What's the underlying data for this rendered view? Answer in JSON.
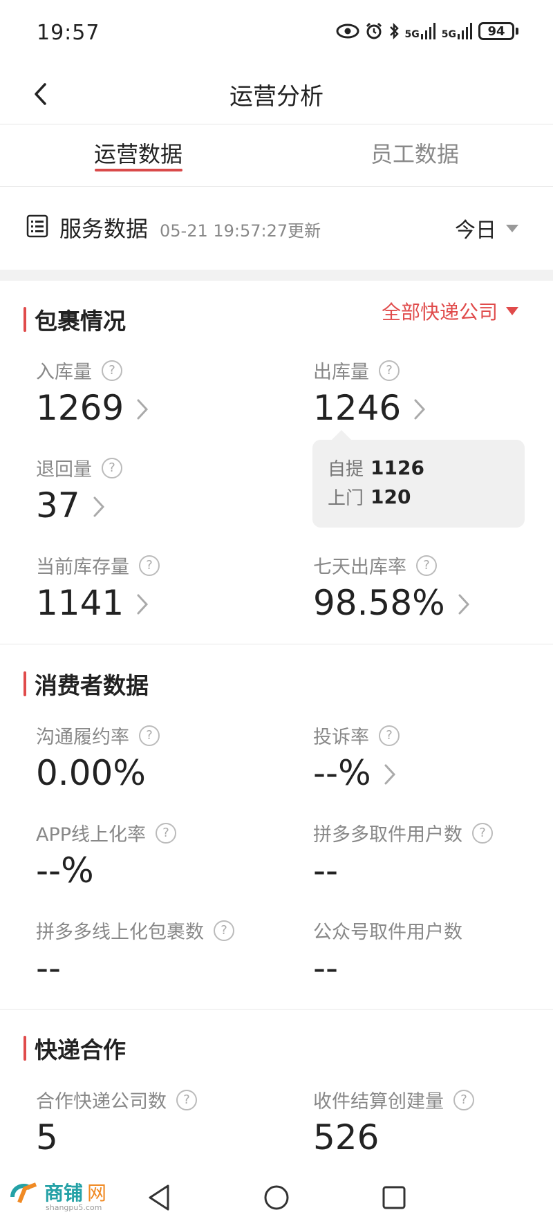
{
  "status_bar": {
    "time": "19:57",
    "battery": "94",
    "net1": "5G",
    "net2": "5G"
  },
  "nav": {
    "title": "运营分析"
  },
  "tabs": [
    {
      "label": "运营数据",
      "active": true
    },
    {
      "label": "员工数据",
      "active": false
    }
  ],
  "service": {
    "title": "服务数据",
    "update_time": "05-21 19:57:27更新",
    "period": "今日"
  },
  "packages": {
    "title": "包裹情况",
    "filter": "全部快递公司",
    "metrics": [
      {
        "label": "入库量",
        "value": "1269"
      },
      {
        "label": "出库量",
        "value": "1246"
      },
      {
        "label": "退回量",
        "value": "37"
      },
      {
        "label": "当前库存量",
        "value": "1141"
      },
      {
        "label": "七天出库率",
        "value": "98.58%"
      }
    ],
    "tooltip": [
      {
        "label": "自提",
        "value": "1126"
      },
      {
        "label": "上门",
        "value": "120"
      }
    ]
  },
  "consumer": {
    "title": "消费者数据",
    "metrics": [
      {
        "label": "沟通履约率",
        "value": "0.00%"
      },
      {
        "label": "投诉率",
        "value": "--%"
      },
      {
        "label": "APP线上化率",
        "value": "--%"
      },
      {
        "label": "拼多多取件用户数",
        "value": "--"
      },
      {
        "label": "拼多多线上化包裹数",
        "value": "--"
      },
      {
        "label": "公众号取件用户数",
        "value": "--"
      }
    ]
  },
  "courier": {
    "title": "快递合作",
    "metrics": [
      {
        "label": "合作快递公司数",
        "value": "5"
      },
      {
        "label": "收件结算创建量",
        "value": "526"
      }
    ]
  },
  "watermark": {
    "text_cn": "商铺",
    "text_net": "网",
    "sub": "shangpu5.com"
  },
  "colors": {
    "accent": "#e04b4b",
    "tab_underline": "#d94a4a",
    "text_primary": "#222222",
    "text_secondary": "#888888"
  }
}
